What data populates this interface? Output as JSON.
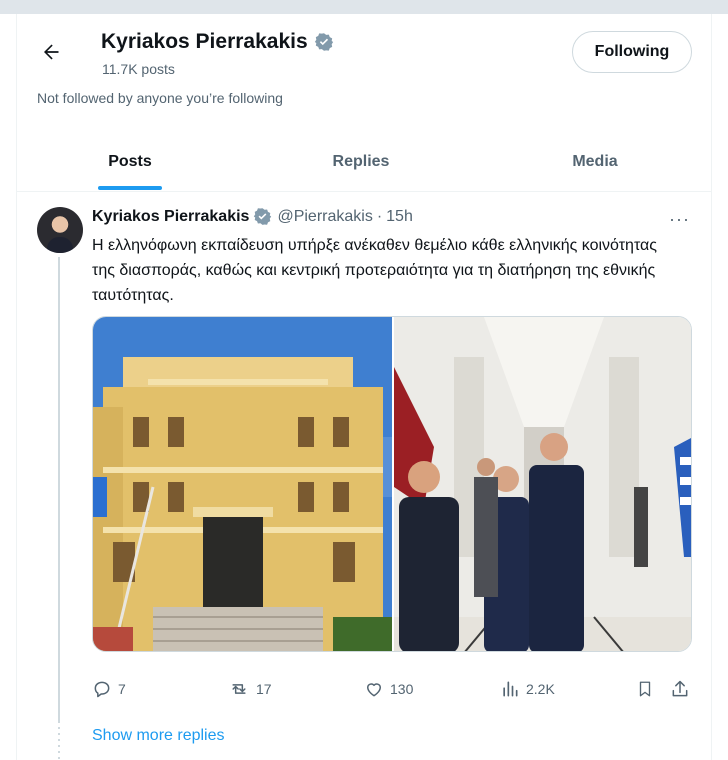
{
  "header": {
    "name": "Kyriakos Pierrakakis",
    "posts_count": "11.7K posts",
    "follow_label": "Following",
    "not_followed": "Not followed by anyone you’re following"
  },
  "tabs": [
    {
      "label": "Posts",
      "active": true
    },
    {
      "label": "Replies",
      "active": false
    },
    {
      "label": "Media",
      "active": false
    }
  ],
  "tweet": {
    "name": "Kyriakos Pierrakakis",
    "handle": "@Pierrakakis",
    "separator": "·",
    "time": "15h",
    "more": "···",
    "text": "Η ελληνόφωνη εκπαίδευση υπήρξε ανέκαθεν θεμέλιο κάθε ελληνικής κοινότητας της διασποράς, καθώς και κεντρική προτεραιότητα για τη διατήρηση της εθνικής ταυτότητας.",
    "stats": {
      "replies": "7",
      "reposts": "17",
      "likes": "130",
      "views": "2.2K"
    }
  },
  "show_more_replies": "Show more replies",
  "colors": {
    "accent": "#1d9bf0",
    "text": "#0f1419",
    "muted": "#536471",
    "border": "#cfd9de"
  },
  "icons": [
    "back-arrow-icon",
    "verified-badge-icon",
    "more-icon",
    "reply-icon",
    "repost-icon",
    "like-icon",
    "views-icon",
    "bookmark-icon",
    "share-icon"
  ]
}
